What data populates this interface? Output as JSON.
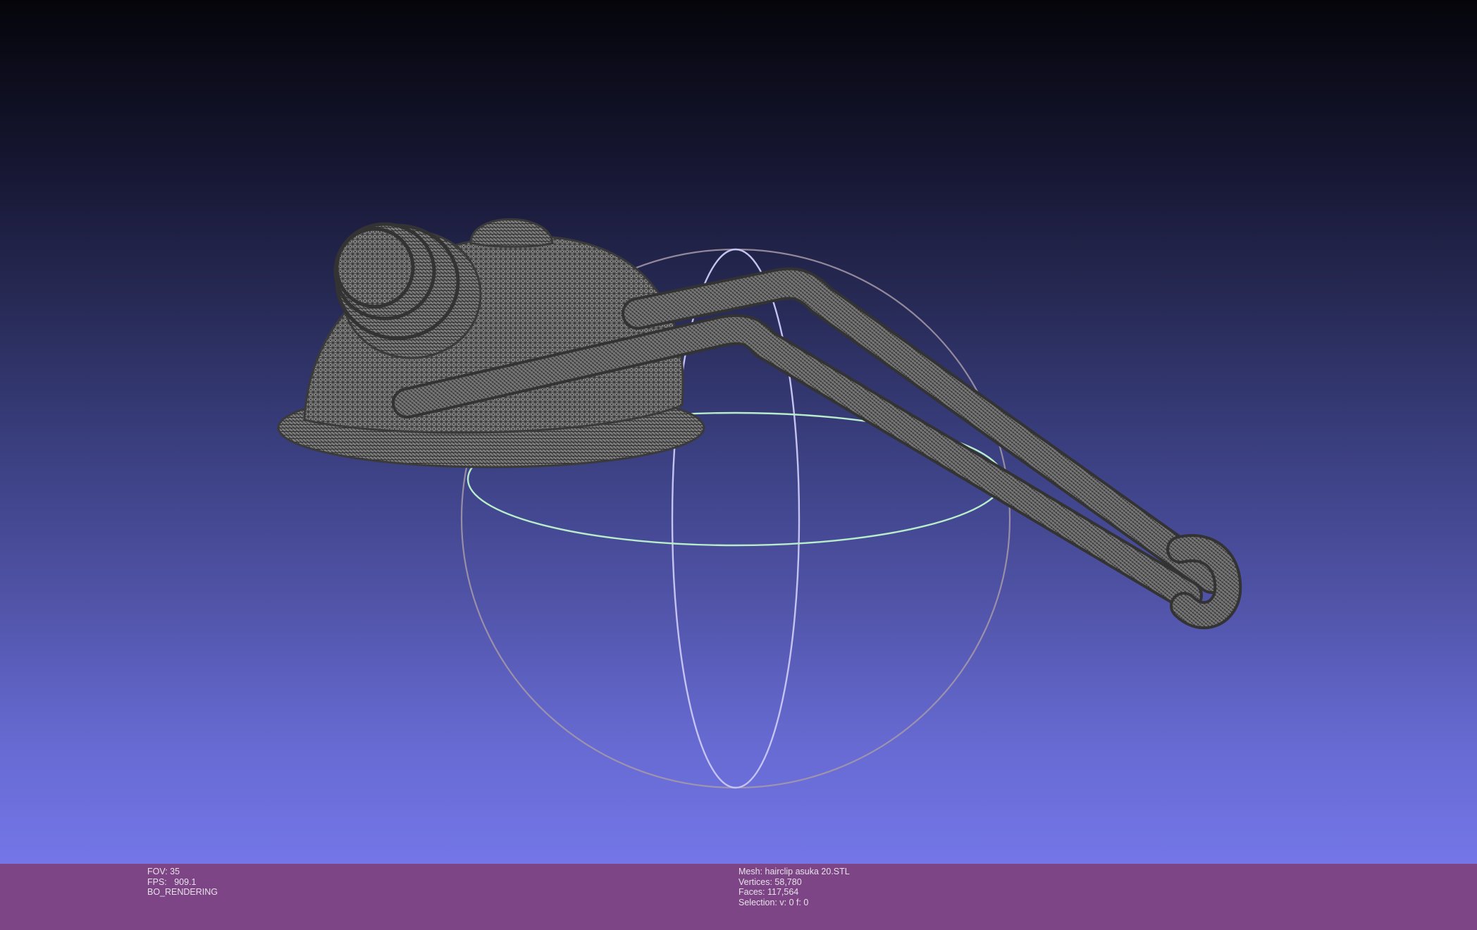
{
  "viewer": {
    "colors": {
      "background_top": "#05050a",
      "background_bottom": "#7476e8",
      "info_bar": "#7e4586",
      "mesh_wire": "#3a3a3a",
      "mesh_fill": "#8c8c8c",
      "trackball_x": "#c6c6ee",
      "trackball_y": "#b8ecc8",
      "trackball_z": "#c8a6c0"
    },
    "trackball": {
      "icon": "trackball-sphere-icon"
    },
    "mesh": {
      "icon": "mesh-wireframe-icon"
    }
  },
  "status_left": {
    "fov": "FOV: 35",
    "fps": "FPS:   909.1",
    "rendering": "BO_RENDERING"
  },
  "status_right": {
    "mesh": "Mesh: hairclip asuka 20.STL",
    "vertices": "Vertices: 58,780",
    "faces": "Faces: 117,564",
    "selection": "Selection: v: 0 f: 0"
  }
}
